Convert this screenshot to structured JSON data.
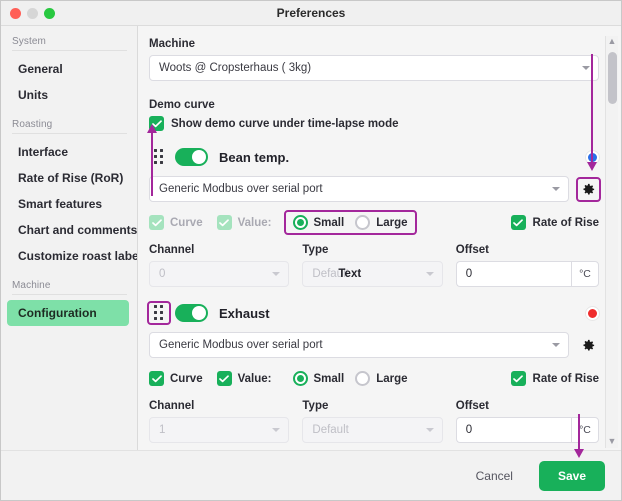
{
  "window": {
    "title": "Preferences",
    "traffic_lights": [
      "close-button",
      "minimize-button",
      "maximize-button"
    ]
  },
  "sidebar": {
    "groups": [
      {
        "label": "System",
        "items": [
          {
            "label": "General",
            "active": false
          },
          {
            "label": "Units",
            "active": false
          }
        ]
      },
      {
        "label": "Roasting",
        "items": [
          {
            "label": "Interface",
            "active": false
          },
          {
            "label": "Rate of Rise (RoR)",
            "active": false
          },
          {
            "label": "Smart features",
            "active": false
          },
          {
            "label": "Chart and comments",
            "active": false
          },
          {
            "label": "Customize roast labels",
            "active": false
          }
        ]
      },
      {
        "label": "Machine",
        "items": [
          {
            "label": "Configuration",
            "active": true
          }
        ]
      }
    ]
  },
  "main": {
    "machine": {
      "label": "Machine",
      "value": "Woots @ Cropsterhaus ( 3kg)"
    },
    "demo_curve": {
      "label": "Demo curve",
      "checkbox_label": "Show demo curve under time-lapse mode",
      "checked": true
    },
    "sensors": [
      {
        "name": "Bean temp.",
        "enabled": true,
        "dot_color": "#2a6ee8",
        "device": "Generic Modbus over serial port",
        "curve_label": "Curve",
        "curve_checked": true,
        "curve_disabled": true,
        "value_label": "Value:",
        "value_checked": true,
        "value_disabled": true,
        "size_options": [
          {
            "label": "Small",
            "selected": true
          },
          {
            "label": "Large",
            "selected": false
          }
        ],
        "ror_label": "Rate of Rise",
        "ror_checked": true,
        "channel_label": "Channel",
        "channel_value": "0",
        "type_label": "Type",
        "type_value": "Default",
        "type_overlay": "Text",
        "offset_label": "Offset",
        "offset_value": "0",
        "offset_unit": "°C"
      },
      {
        "name": "Exhaust",
        "enabled": true,
        "dot_color": "#ef2d2d",
        "device": "Generic Modbus over serial port",
        "curve_label": "Curve",
        "curve_checked": true,
        "curve_disabled": false,
        "value_label": "Value:",
        "value_checked": true,
        "value_disabled": false,
        "size_options": [
          {
            "label": "Small",
            "selected": true
          },
          {
            "label": "Large",
            "selected": false
          }
        ],
        "ror_label": "Rate of Rise",
        "ror_checked": true,
        "channel_label": "Channel",
        "channel_value": "1",
        "type_label": "Type",
        "type_value": "Default",
        "offset_label": "Offset",
        "offset_value": "0",
        "offset_unit": "°C"
      }
    ]
  },
  "footer": {
    "cancel_label": "Cancel",
    "save_label": "Save"
  },
  "annotations": {
    "highlight_color": "#a3279b",
    "highlighted": [
      "bean-temp-gear-icon",
      "bean-temp-size-radio-group",
      "exhaust-drag-handle"
    ],
    "arrows": [
      "scrollbar-down-arrow",
      "drag-handle-up-arrow",
      "save-button-down-arrow"
    ]
  },
  "colors": {
    "accent_green": "#18b05a",
    "sidebar_active": "#7ee0a8",
    "annotation_purple": "#a3279b"
  }
}
